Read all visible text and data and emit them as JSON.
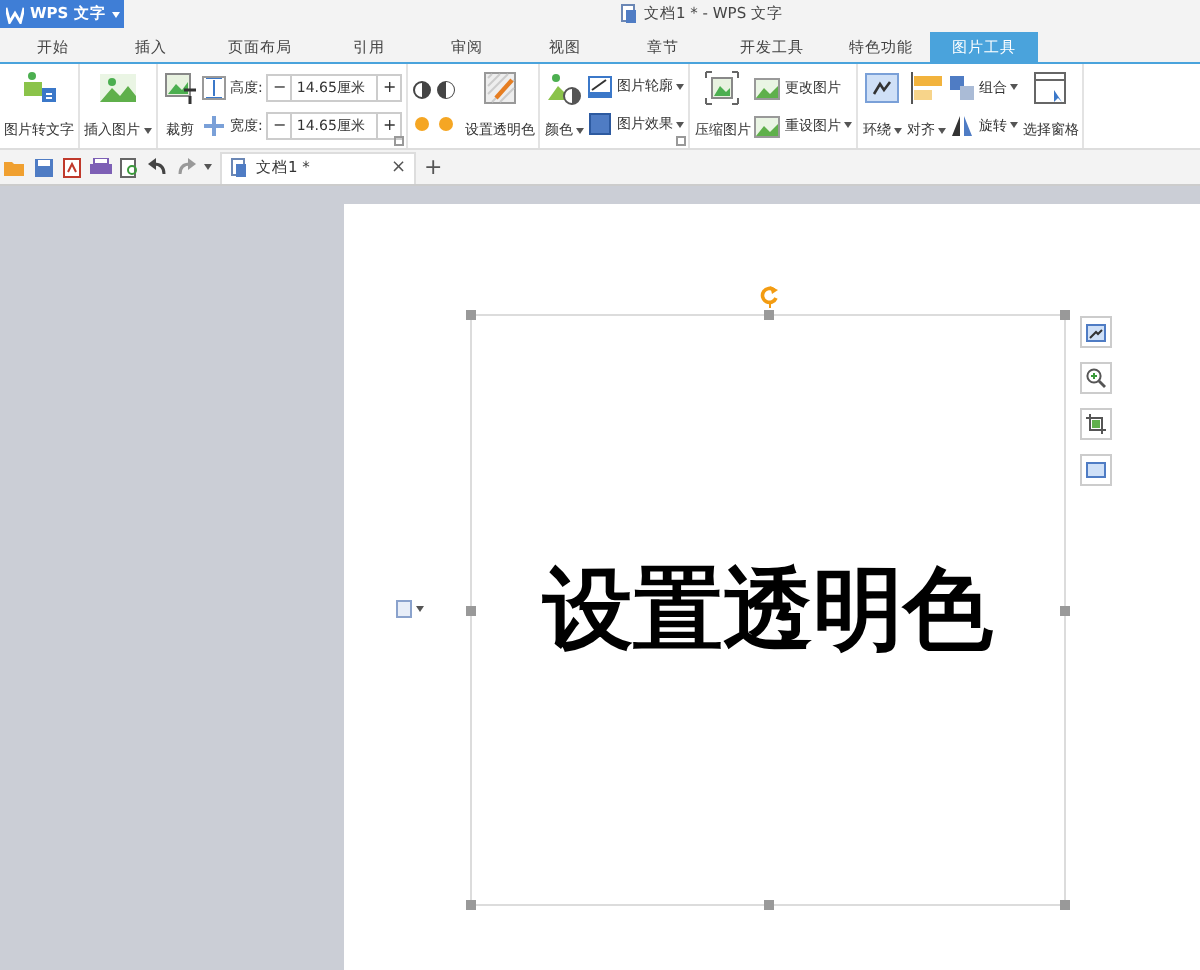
{
  "app_menu": {
    "label": "WPS 文字",
    "dropdown": true
  },
  "window": {
    "title": "文档1 * - WPS 文字"
  },
  "tabs": [
    {
      "label": "开始",
      "selected": false
    },
    {
      "label": "插入",
      "selected": false
    },
    {
      "label": "页面布局",
      "selected": false
    },
    {
      "label": "引用",
      "selected": false
    },
    {
      "label": "审阅",
      "selected": false
    },
    {
      "label": "视图",
      "selected": false
    },
    {
      "label": "章节",
      "selected": false
    },
    {
      "label": "开发工具",
      "selected": false
    },
    {
      "label": "特色功能",
      "selected": false
    },
    {
      "label": "图片工具",
      "selected": true
    }
  ],
  "ribbon": {
    "groups": [
      {
        "launcher": false,
        "items": [
          {
            "kind": "large",
            "label": "图片转文字",
            "dropdown": false
          }
        ]
      },
      {
        "launcher": false,
        "items": [
          {
            "kind": "large",
            "label": "插入图片",
            "dropdown": true
          }
        ]
      },
      {
        "launcher": true,
        "items": [
          {
            "kind": "large",
            "label": "裁剪",
            "dropdown": false
          },
          {
            "kind": "size",
            "rows": [
              {
                "label": "高度:",
                "value": "14.65厘米",
                "decrease": "−",
                "increase": "+"
              },
              {
                "label": "宽度:",
                "value": "14.65厘米",
                "decrease": "−",
                "increase": "+"
              }
            ]
          }
        ]
      },
      {
        "launcher": false,
        "items": [
          {
            "kind": "adjust"
          },
          {
            "kind": "large",
            "label": "设置透明色",
            "dropdown": false
          }
        ]
      },
      {
        "launcher": true,
        "items": [
          {
            "kind": "large",
            "label": "颜色",
            "dropdown": true
          },
          {
            "kind": "stack",
            "rows": [
              {
                "label": "图片轮廓",
                "dropdown": true
              },
              {
                "label": "图片效果",
                "dropdown": true
              }
            ]
          }
        ]
      },
      {
        "launcher": false,
        "items": [
          {
            "kind": "large",
            "label": "压缩图片",
            "dropdown": false
          },
          {
            "kind": "stack",
            "rows": [
              {
                "label": "更改图片",
                "dropdown": false
              },
              {
                "label": "重设图片",
                "dropdown": true
              }
            ]
          }
        ]
      },
      {
        "launcher": false,
        "items": [
          {
            "kind": "large",
            "label": "环绕",
            "dropdown": true
          },
          {
            "kind": "large",
            "label": "对齐",
            "dropdown": true
          },
          {
            "kind": "stack",
            "rows": [
              {
                "label": "组合",
                "dropdown": true
              },
              {
                "label": "旋转",
                "dropdown": true
              }
            ]
          },
          {
            "kind": "large",
            "label": "选择窗格",
            "dropdown": false
          }
        ]
      }
    ]
  },
  "documents": [
    {
      "label": "文档1 *",
      "selected": true,
      "close": "×"
    }
  ],
  "new_tab": "+",
  "picture_text": "设置透明色"
}
